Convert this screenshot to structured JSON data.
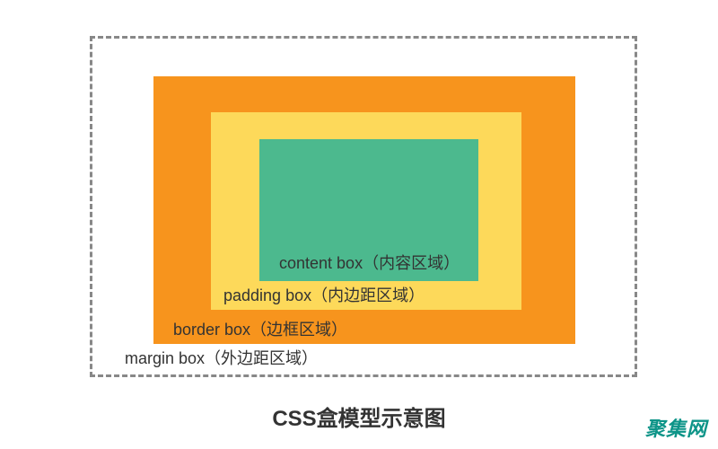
{
  "diagram": {
    "margin": {
      "label": "margin box（外边距区域）",
      "color": "#ffffff",
      "border_style": "dashed"
    },
    "border": {
      "label": "border box（边框区域）",
      "color": "#f7941d"
    },
    "padding": {
      "label": "padding box（内边距区域）",
      "color": "#fdd95a"
    },
    "content": {
      "label": "content box（内容区域）",
      "color": "#4cb98e"
    }
  },
  "title": "CSS盒模型示意图",
  "watermark": "聚集网"
}
